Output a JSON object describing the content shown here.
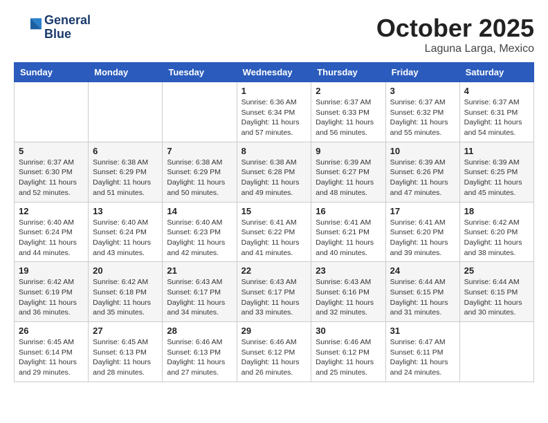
{
  "header": {
    "logo_line1": "General",
    "logo_line2": "Blue",
    "month_title": "October 2025",
    "location": "Laguna Larga, Mexico"
  },
  "weekdays": [
    "Sunday",
    "Monday",
    "Tuesday",
    "Wednesday",
    "Thursday",
    "Friday",
    "Saturday"
  ],
  "weeks": [
    [
      {
        "day": "",
        "info": ""
      },
      {
        "day": "",
        "info": ""
      },
      {
        "day": "",
        "info": ""
      },
      {
        "day": "1",
        "info": "Sunrise: 6:36 AM\nSunset: 6:34 PM\nDaylight: 11 hours and 57 minutes."
      },
      {
        "day": "2",
        "info": "Sunrise: 6:37 AM\nSunset: 6:33 PM\nDaylight: 11 hours and 56 minutes."
      },
      {
        "day": "3",
        "info": "Sunrise: 6:37 AM\nSunset: 6:32 PM\nDaylight: 11 hours and 55 minutes."
      },
      {
        "day": "4",
        "info": "Sunrise: 6:37 AM\nSunset: 6:31 PM\nDaylight: 11 hours and 54 minutes."
      }
    ],
    [
      {
        "day": "5",
        "info": "Sunrise: 6:37 AM\nSunset: 6:30 PM\nDaylight: 11 hours and 52 minutes."
      },
      {
        "day": "6",
        "info": "Sunrise: 6:38 AM\nSunset: 6:29 PM\nDaylight: 11 hours and 51 minutes."
      },
      {
        "day": "7",
        "info": "Sunrise: 6:38 AM\nSunset: 6:29 PM\nDaylight: 11 hours and 50 minutes."
      },
      {
        "day": "8",
        "info": "Sunrise: 6:38 AM\nSunset: 6:28 PM\nDaylight: 11 hours and 49 minutes."
      },
      {
        "day": "9",
        "info": "Sunrise: 6:39 AM\nSunset: 6:27 PM\nDaylight: 11 hours and 48 minutes."
      },
      {
        "day": "10",
        "info": "Sunrise: 6:39 AM\nSunset: 6:26 PM\nDaylight: 11 hours and 47 minutes."
      },
      {
        "day": "11",
        "info": "Sunrise: 6:39 AM\nSunset: 6:25 PM\nDaylight: 11 hours and 45 minutes."
      }
    ],
    [
      {
        "day": "12",
        "info": "Sunrise: 6:40 AM\nSunset: 6:24 PM\nDaylight: 11 hours and 44 minutes."
      },
      {
        "day": "13",
        "info": "Sunrise: 6:40 AM\nSunset: 6:24 PM\nDaylight: 11 hours and 43 minutes."
      },
      {
        "day": "14",
        "info": "Sunrise: 6:40 AM\nSunset: 6:23 PM\nDaylight: 11 hours and 42 minutes."
      },
      {
        "day": "15",
        "info": "Sunrise: 6:41 AM\nSunset: 6:22 PM\nDaylight: 11 hours and 41 minutes."
      },
      {
        "day": "16",
        "info": "Sunrise: 6:41 AM\nSunset: 6:21 PM\nDaylight: 11 hours and 40 minutes."
      },
      {
        "day": "17",
        "info": "Sunrise: 6:41 AM\nSunset: 6:20 PM\nDaylight: 11 hours and 39 minutes."
      },
      {
        "day": "18",
        "info": "Sunrise: 6:42 AM\nSunset: 6:20 PM\nDaylight: 11 hours and 38 minutes."
      }
    ],
    [
      {
        "day": "19",
        "info": "Sunrise: 6:42 AM\nSunset: 6:19 PM\nDaylight: 11 hours and 36 minutes."
      },
      {
        "day": "20",
        "info": "Sunrise: 6:42 AM\nSunset: 6:18 PM\nDaylight: 11 hours and 35 minutes."
      },
      {
        "day": "21",
        "info": "Sunrise: 6:43 AM\nSunset: 6:17 PM\nDaylight: 11 hours and 34 minutes."
      },
      {
        "day": "22",
        "info": "Sunrise: 6:43 AM\nSunset: 6:17 PM\nDaylight: 11 hours and 33 minutes."
      },
      {
        "day": "23",
        "info": "Sunrise: 6:43 AM\nSunset: 6:16 PM\nDaylight: 11 hours and 32 minutes."
      },
      {
        "day": "24",
        "info": "Sunrise: 6:44 AM\nSunset: 6:15 PM\nDaylight: 11 hours and 31 minutes."
      },
      {
        "day": "25",
        "info": "Sunrise: 6:44 AM\nSunset: 6:15 PM\nDaylight: 11 hours and 30 minutes."
      }
    ],
    [
      {
        "day": "26",
        "info": "Sunrise: 6:45 AM\nSunset: 6:14 PM\nDaylight: 11 hours and 29 minutes."
      },
      {
        "day": "27",
        "info": "Sunrise: 6:45 AM\nSunset: 6:13 PM\nDaylight: 11 hours and 28 minutes."
      },
      {
        "day": "28",
        "info": "Sunrise: 6:46 AM\nSunset: 6:13 PM\nDaylight: 11 hours and 27 minutes."
      },
      {
        "day": "29",
        "info": "Sunrise: 6:46 AM\nSunset: 6:12 PM\nDaylight: 11 hours and 26 minutes."
      },
      {
        "day": "30",
        "info": "Sunrise: 6:46 AM\nSunset: 6:12 PM\nDaylight: 11 hours and 25 minutes."
      },
      {
        "day": "31",
        "info": "Sunrise: 6:47 AM\nSunset: 6:11 PM\nDaylight: 11 hours and 24 minutes."
      },
      {
        "day": "",
        "info": ""
      }
    ]
  ]
}
